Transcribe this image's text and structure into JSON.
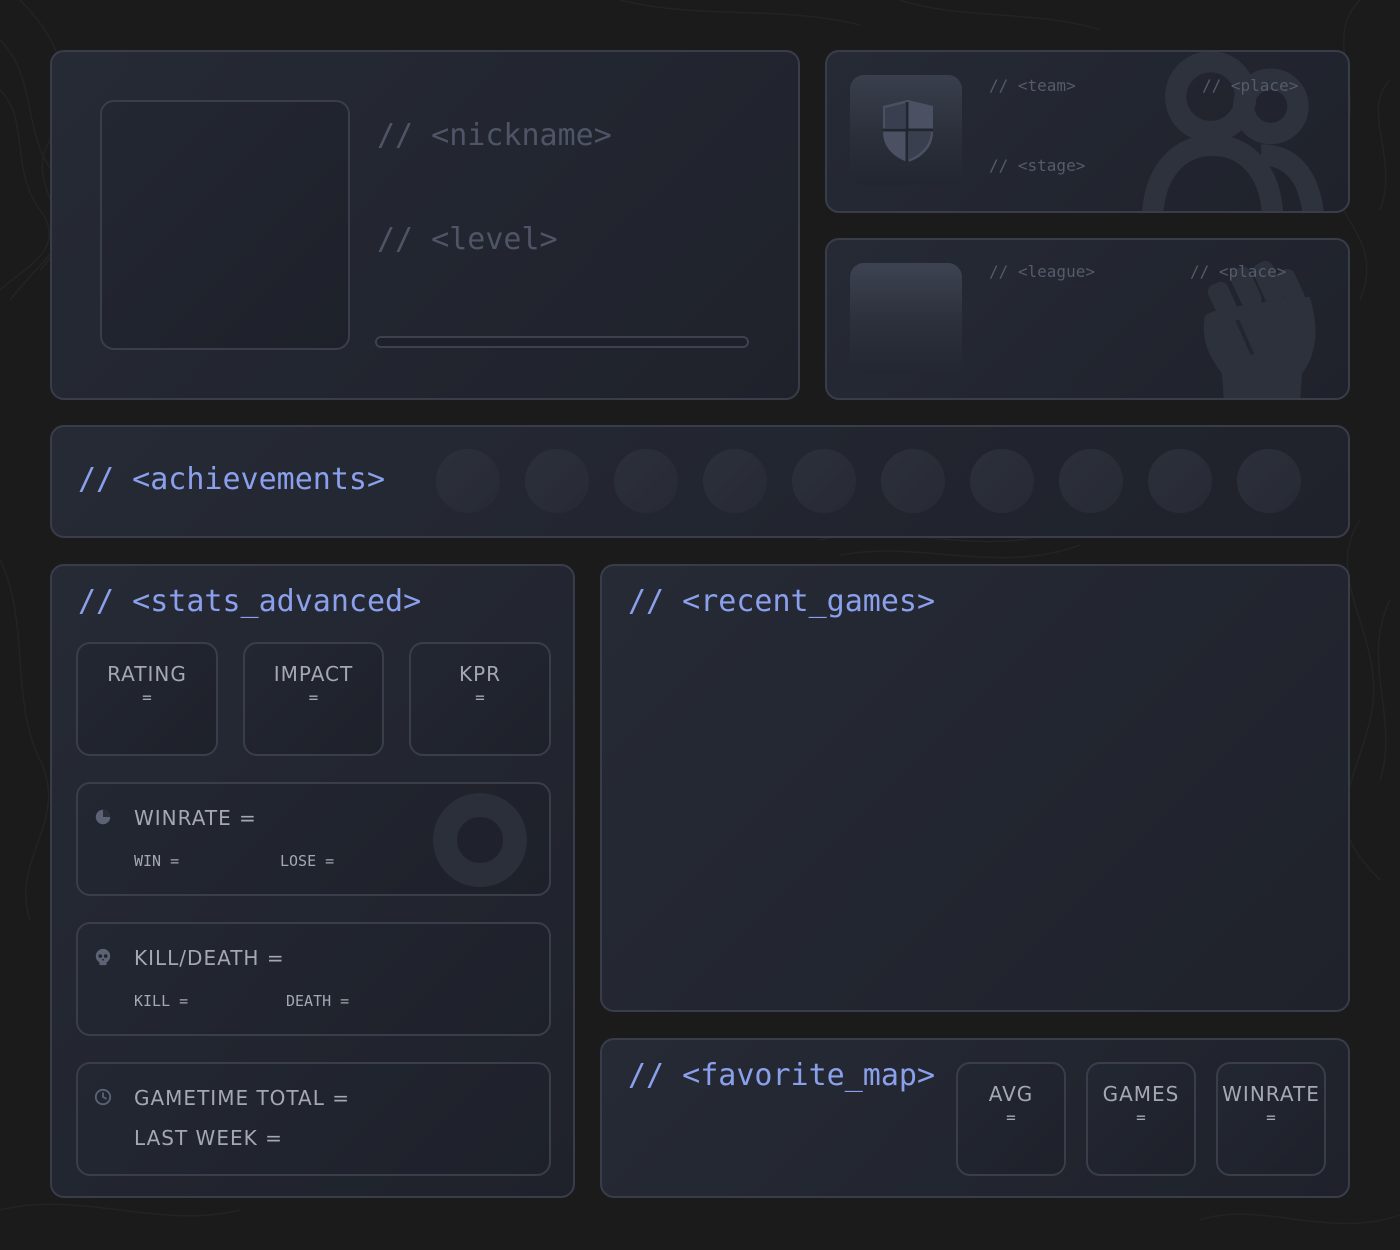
{
  "profile": {
    "nickname_placeholder": "// <nickname>",
    "level_placeholder": "// <level>",
    "level_progress": 0
  },
  "team_card": {
    "team_label": "// <team>",
    "place_label": "// <place>",
    "stage_label": "// <stage>"
  },
  "league_card": {
    "league_label": "// <league>",
    "place_label": "// <place>"
  },
  "achievements": {
    "title": "// <achievements>",
    "badge_count": 10
  },
  "stats_advanced": {
    "title": "// <stats_advanced>",
    "boxes": [
      {
        "label": "RATING",
        "value": "="
      },
      {
        "label": "IMPACT",
        "value": "="
      },
      {
        "label": "KPR",
        "value": "="
      }
    ],
    "winrate": {
      "label": "WINRATE =",
      "win": "WIN =",
      "lose": "LOSE ="
    },
    "kd": {
      "label": "KILL/DEATH =",
      "kill": "KILL =",
      "death": "DEATH ="
    },
    "gametime": {
      "total": "GAMETIME TOTAL =",
      "week": "LAST WEEK ="
    }
  },
  "recent_games": {
    "title": "// <recent_games>"
  },
  "favorite_map": {
    "title": "// <favorite_map>",
    "boxes": [
      {
        "label": "AVG",
        "value": "="
      },
      {
        "label": "GAMES",
        "value": "="
      },
      {
        "label": "WINRATE",
        "value": "="
      }
    ]
  },
  "colors": {
    "background": "#1b1b1c",
    "card": "#232732",
    "accent": "#8aa0ec",
    "border": "#393d4a"
  },
  "icons": [
    "shield-icon",
    "group-icon",
    "fist-icon",
    "pie-chart-icon",
    "skull-icon",
    "clock-icon"
  ]
}
